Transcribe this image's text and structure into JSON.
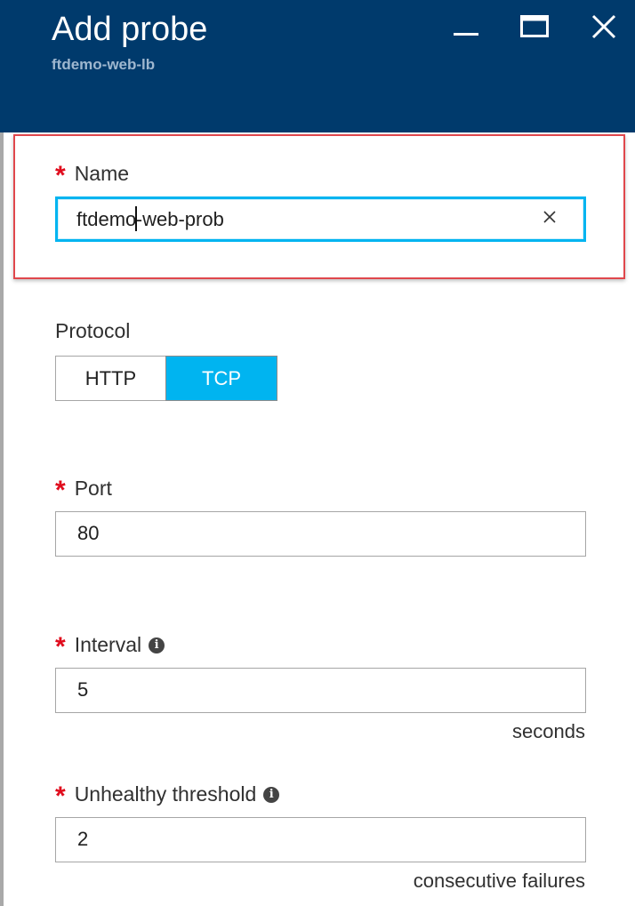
{
  "header": {
    "title": "Add probe",
    "subtitle": "ftdemo-web-lb",
    "controls": {
      "minimize": "minimize-icon",
      "maximize": "maximize-icon",
      "close": "close-icon"
    }
  },
  "name_field": {
    "label": "Name",
    "required_mark": "*",
    "value_before_caret": "ftdemo",
    "value_after_caret": "-web-prob"
  },
  "protocol": {
    "label": "Protocol",
    "options": [
      "HTTP",
      "TCP"
    ],
    "selected": "TCP"
  },
  "port_field": {
    "label": "Port",
    "required_mark": "*",
    "value": "80"
  },
  "interval_field": {
    "label": "Interval",
    "required_mark": "*",
    "info_icon": "i",
    "value": "5",
    "suffix": "seconds"
  },
  "threshold_field": {
    "label": "Unhealthy threshold",
    "required_mark": "*",
    "info_icon": "i",
    "value": "2",
    "suffix": "consecutive failures"
  },
  "colors": {
    "header_bg": "#003a6c",
    "accent": "#00b4f0",
    "required": "#e00b1c",
    "highlight_border": "#e0474c"
  }
}
